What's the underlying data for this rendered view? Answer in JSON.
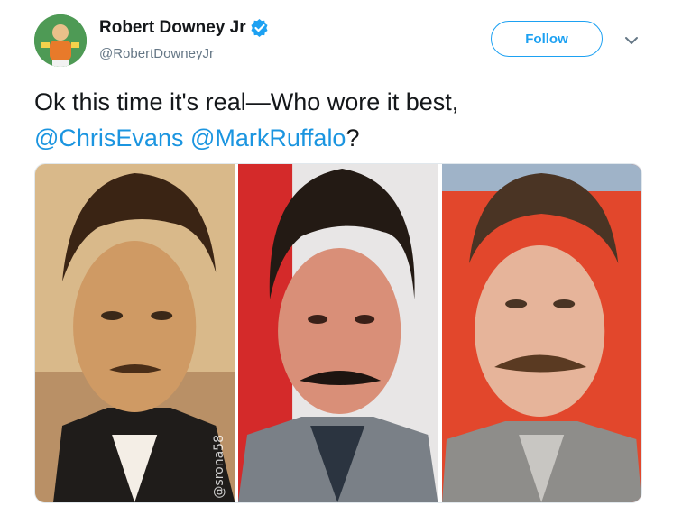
{
  "author": {
    "display_name": "Robert Downey Jr",
    "handle": "@RobertDowneyJr",
    "verified": true
  },
  "follow_label": "Follow",
  "tweet": {
    "text_main": "Ok this time it's real—Who wore it best,",
    "mention1": "@ChrisEvans",
    "mention2": "@MarkRuffalo",
    "end": "?"
  },
  "media": {
    "watermark": "@srona58"
  },
  "colors": {
    "accent": "#1da1f2",
    "mention": "#1b95e0",
    "secondary_text": "#657786"
  }
}
